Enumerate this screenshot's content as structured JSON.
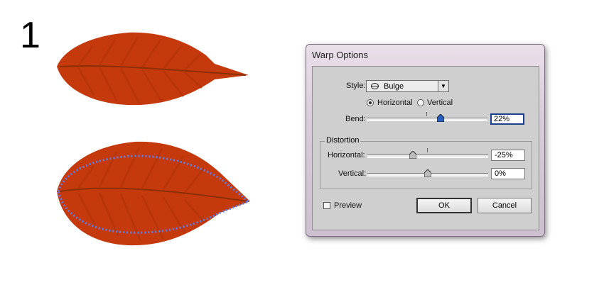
{
  "step_number": "1",
  "dialog": {
    "title": "Warp Options",
    "style": {
      "label": "Style:",
      "selected": "Bulge",
      "icon": "bulge-icon",
      "dropdown_icon": "▼"
    },
    "orientation": {
      "horizontal_label": "Horizontal",
      "vertical_label": "Vertical",
      "selected": "horizontal"
    },
    "bend": {
      "label": "Bend:",
      "value": "22%",
      "level": 0.22
    },
    "distortion": {
      "title": "Distortion",
      "horizontal": {
        "label": "Horizontal:",
        "value": "-25%",
        "level": -0.25
      },
      "vertical": {
        "label": "Vertical:",
        "value": "0%",
        "level": 0
      }
    },
    "preview": {
      "label": "Preview",
      "checked": false
    },
    "buttons": {
      "ok": "OK",
      "cancel": "Cancel"
    }
  },
  "colors": {
    "leaf": "#c53a0c",
    "leaf_vein": "#8a2f07",
    "path_outline": "#5a7ff0"
  }
}
